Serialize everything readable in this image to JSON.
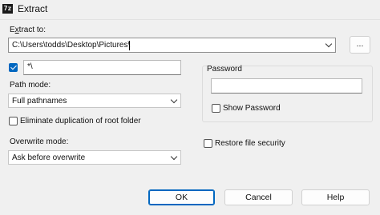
{
  "window": {
    "app_icon_text": "7z",
    "title": "Extract"
  },
  "extract_to": {
    "label_prefix": "E",
    "label_underlined": "x",
    "label_suffix": "tract to:",
    "path": "C:\\Users\\todds\\Desktop\\Pictures\\",
    "browse_label": "..."
  },
  "subfolder": {
    "checked": true,
    "value": "*\\"
  },
  "path_mode": {
    "label": "Path mode:",
    "value": "Full pathnames"
  },
  "eliminate_duplication": {
    "checked": false,
    "label": "Eliminate duplication of root folder"
  },
  "overwrite_mode": {
    "label": "Overwrite mode:",
    "value": "Ask before overwrite"
  },
  "password": {
    "group_label": "Password",
    "value": "",
    "show_checked": false,
    "show_label": "Show Password"
  },
  "restore_security": {
    "checked": false,
    "label": "Restore file security"
  },
  "buttons": {
    "ok": "OK",
    "cancel": "Cancel",
    "help": "Help"
  },
  "colors": {
    "accent": "#0067c0",
    "background": "#f0f0f0"
  }
}
